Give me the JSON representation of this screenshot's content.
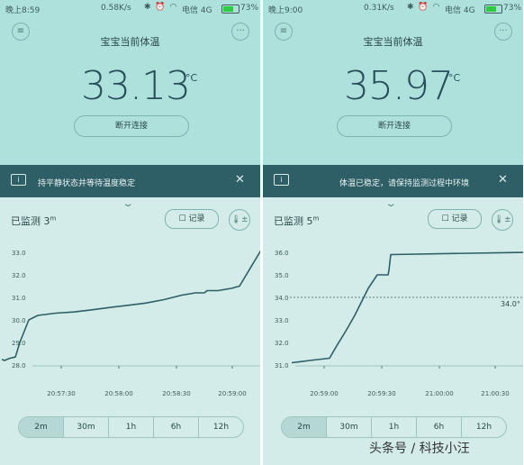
{
  "panels": [
    {
      "status": {
        "time": "晚上8:59",
        "net": "0.58K/s",
        "carrier": "电信 4G",
        "battery": "73%"
      },
      "menu_icon": "list-icon",
      "more_icon": "more-icon",
      "title": "宝宝当前体温",
      "temperature": "33.13",
      "unit": "°C",
      "disconnect_label": "断开连接",
      "banner": {
        "message": "持平静状态并等待温度稳定"
      },
      "monitored": {
        "label": "已监测",
        "value": "3",
        "unit": "m"
      },
      "record_label": "记录",
      "ranges": [
        "2m",
        "30m",
        "1h",
        "6h",
        "12h"
      ],
      "chart_data": {
        "type": "line",
        "yticks": [
          "28.0",
          "29.0",
          "30.0",
          "31.0",
          "32.0",
          "33.0"
        ],
        "ylim": [
          28.0,
          33.0
        ],
        "xticks": [
          "20:57:30",
          "20:58:00",
          "20:58:30",
          "20:59:00"
        ],
        "x": [
          0,
          3,
          9,
          15,
          17,
          20,
          25,
          30,
          40,
          60,
          80,
          100,
          120,
          140,
          160,
          180,
          190,
          200,
          215,
          225,
          228,
          240,
          255,
          264,
          288
        ],
        "y": [
          28.25,
          28.2,
          28.3,
          28.35,
          28.6,
          29.0,
          29.5,
          30.0,
          30.2,
          30.3,
          30.35,
          30.45,
          30.55,
          30.65,
          30.75,
          30.9,
          31.0,
          31.1,
          31.2,
          31.2,
          31.3,
          31.3,
          31.4,
          31.5,
          33.1
        ]
      }
    },
    {
      "status": {
        "time": "晚上9:00",
        "net": "0.31K/s",
        "carrier": "电信 4G",
        "battery": "73%"
      },
      "menu_icon": "list-icon",
      "more_icon": "more-icon",
      "title": "宝宝当前体温",
      "temperature": "35.97",
      "unit": "°C",
      "disconnect_label": "断开连接",
      "banner": {
        "message": "体温已稳定，请保持监测过程中环境"
      },
      "monitored": {
        "label": "已监测",
        "value": "5",
        "unit": "m"
      },
      "record_label": "记录",
      "ranges": [
        "2m",
        "30m",
        "1h",
        "6h",
        "12h"
      ],
      "chart_data": {
        "type": "line",
        "yticks": [
          "31.0",
          "32.0",
          "33.0",
          "34.0",
          "35.0",
          "36.0"
        ],
        "ylim": [
          31.0,
          36.0
        ],
        "xticks": [
          "20:59:00",
          "20:59:30",
          "21:00:00",
          "21:00:30"
        ],
        "threshold": {
          "value": 34.0,
          "label": "34.0°"
        },
        "x": [
          30,
          40,
          50,
          72,
          80,
          90,
          100,
          115,
          125,
          137,
          138,
          140,
          288
        ],
        "y": [
          31.1,
          31.15,
          31.2,
          31.3,
          31.85,
          32.5,
          33.2,
          34.4,
          35.0,
          35.0,
          35.2,
          35.9,
          36.0
        ]
      }
    }
  ],
  "watermark": "头条号 / 科技小汪"
}
